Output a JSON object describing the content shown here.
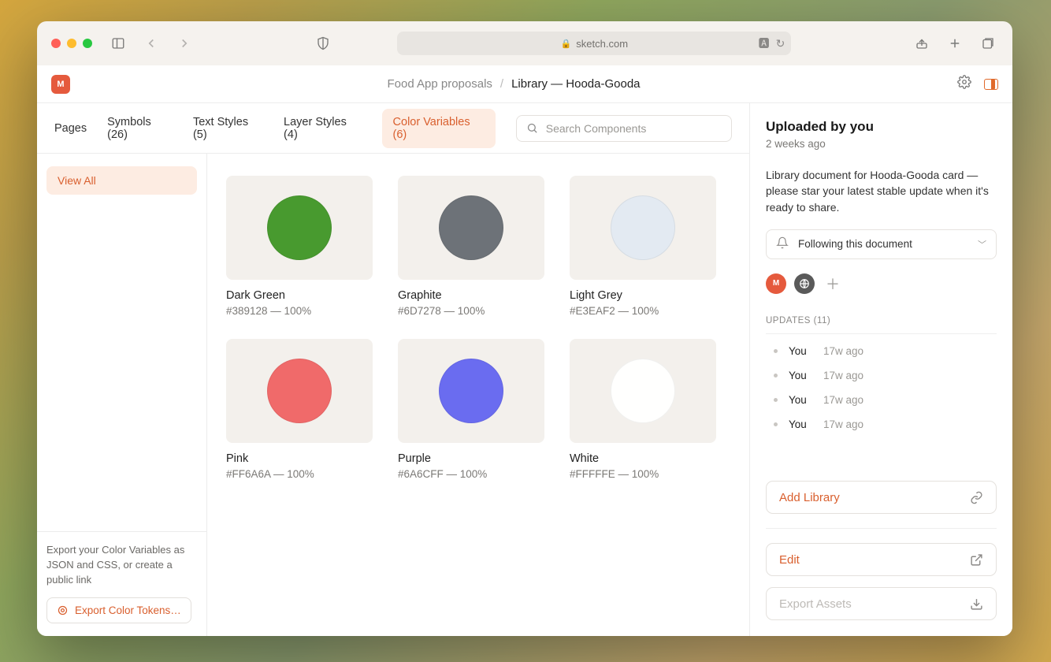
{
  "browser": {
    "url_host": "sketch.com"
  },
  "breadcrumb": {
    "project": "Food App proposals",
    "page": "Library — Hooda-Gooda"
  },
  "tabs": [
    {
      "label": "Pages"
    },
    {
      "label": "Symbols (26)"
    },
    {
      "label": "Text Styles (5)"
    },
    {
      "label": "Layer Styles (4)"
    },
    {
      "label": "Color Variables (6)",
      "active": true
    }
  ],
  "search": {
    "placeholder": "Search Components"
  },
  "sidebar": {
    "view_all": "View All",
    "export_desc": "Export your Color Variables as JSON and CSS, or create a public link",
    "export_btn": "Export Color Tokens…"
  },
  "swatches": [
    {
      "name": "Dark Green",
      "hex": "#389128",
      "opacity": "100%",
      "color": "#489a2f"
    },
    {
      "name": "Graphite",
      "hex": "#6D7278",
      "opacity": "100%",
      "color": "#6d7278"
    },
    {
      "name": "Light Grey",
      "hex": "#E3EAF2",
      "opacity": "100%",
      "color": "#e3eaf2"
    },
    {
      "name": "Pink",
      "hex": "#FF6A6A",
      "opacity": "100%",
      "color": "#f06a6a"
    },
    {
      "name": "Purple",
      "hex": "#6A6CFF",
      "opacity": "100%",
      "color": "#6a6cf0"
    },
    {
      "name": "White",
      "hex": "#FFFFFE",
      "opacity": "100%",
      "color": "#fffffe"
    }
  ],
  "right": {
    "title": "Uploaded by you",
    "subtitle": "2 weeks ago",
    "description": "Library document for Hooda-Gooda card — please star your latest stable update when it's ready to share.",
    "follow": "Following this document",
    "updates_label": "UPDATES (11)",
    "updates": [
      {
        "who": "You",
        "when": "17w ago"
      },
      {
        "who": "You",
        "when": "17w ago"
      },
      {
        "who": "You",
        "when": "17w ago"
      },
      {
        "who": "You",
        "when": "17w ago"
      }
    ],
    "actions": {
      "add_library": "Add Library",
      "edit": "Edit",
      "export_assets": "Export Assets"
    }
  }
}
